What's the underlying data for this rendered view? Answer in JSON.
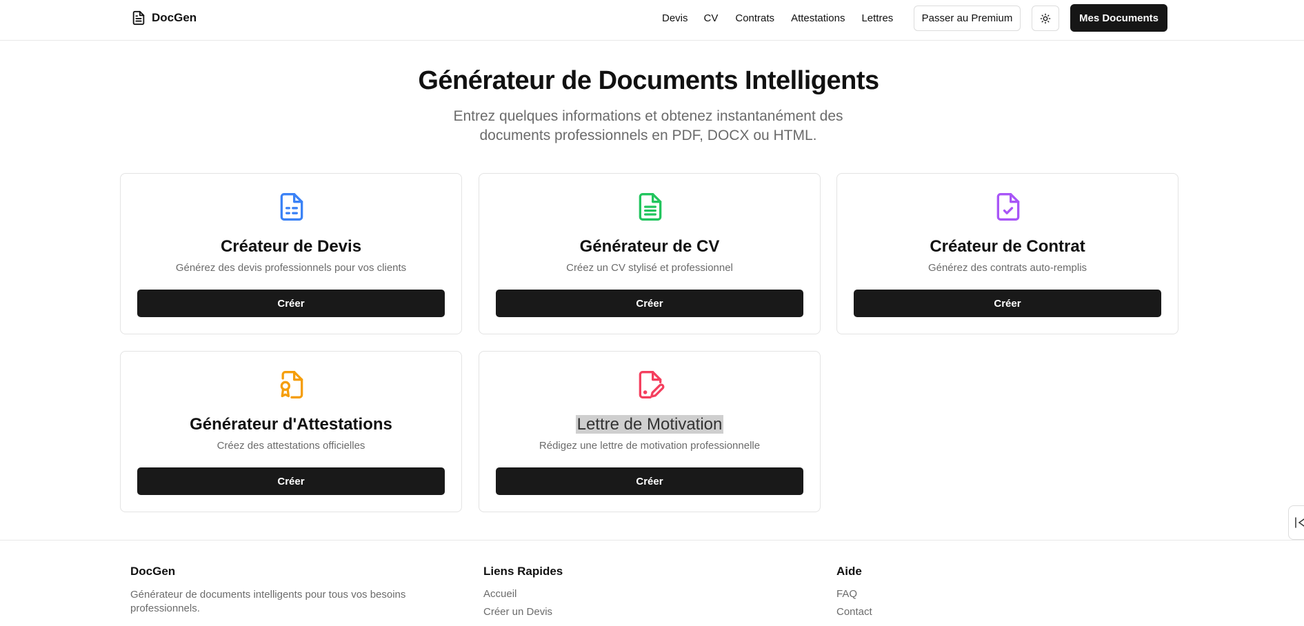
{
  "brand": {
    "name": "DocGen",
    "icon": "file-text-icon"
  },
  "nav": {
    "links": [
      "Devis",
      "CV",
      "Contrats",
      "Attestations",
      "Lettres"
    ],
    "premium_label": "Passer au Premium",
    "theme_icon": "sun-icon",
    "documents_label": "Mes Documents"
  },
  "hero": {
    "title": "Générateur de Documents Intelligents",
    "subtitle": "Entrez quelques informations et obtenez instantanément des documents professionnels en PDF, DOCX ou HTML."
  },
  "cards": [
    {
      "title": "Créateur de Devis",
      "description": "Générez des devis professionnels pour vos clients",
      "button": "Créer",
      "icon": "invoice-icon",
      "color": "#3b82f6"
    },
    {
      "title": "Générateur de CV",
      "description": "Créez un CV stylisé et professionnel",
      "button": "Créer",
      "icon": "file-spreadsheet-icon",
      "color": "#22c55e"
    },
    {
      "title": "Créateur de Contrat",
      "description": "Générez des contrats auto-remplis",
      "button": "Créer",
      "icon": "file-check-icon",
      "color": "#a855f7"
    },
    {
      "title": "Générateur d'Attestations",
      "description": "Créez des attestations officielles",
      "button": "Créer",
      "icon": "file-badge-icon",
      "color": "#f59e0b"
    },
    {
      "title": "Lettre de Motivation",
      "description": "Rédigez une lettre de motivation professionnelle",
      "button": "Créer",
      "icon": "file-pen-icon",
      "color": "#f43f5e"
    }
  ],
  "footer": {
    "about": {
      "title": "DocGen",
      "text": "Générateur de documents intelligents pour tous vos besoins professionnels."
    },
    "quick_links": {
      "title": "Liens Rapides",
      "items": [
        "Accueil",
        "Créer un Devis"
      ]
    },
    "help": {
      "title": "Aide",
      "items": [
        "FAQ",
        "Contact"
      ]
    }
  },
  "side_widget": {
    "icon": "collapse-icon"
  }
}
